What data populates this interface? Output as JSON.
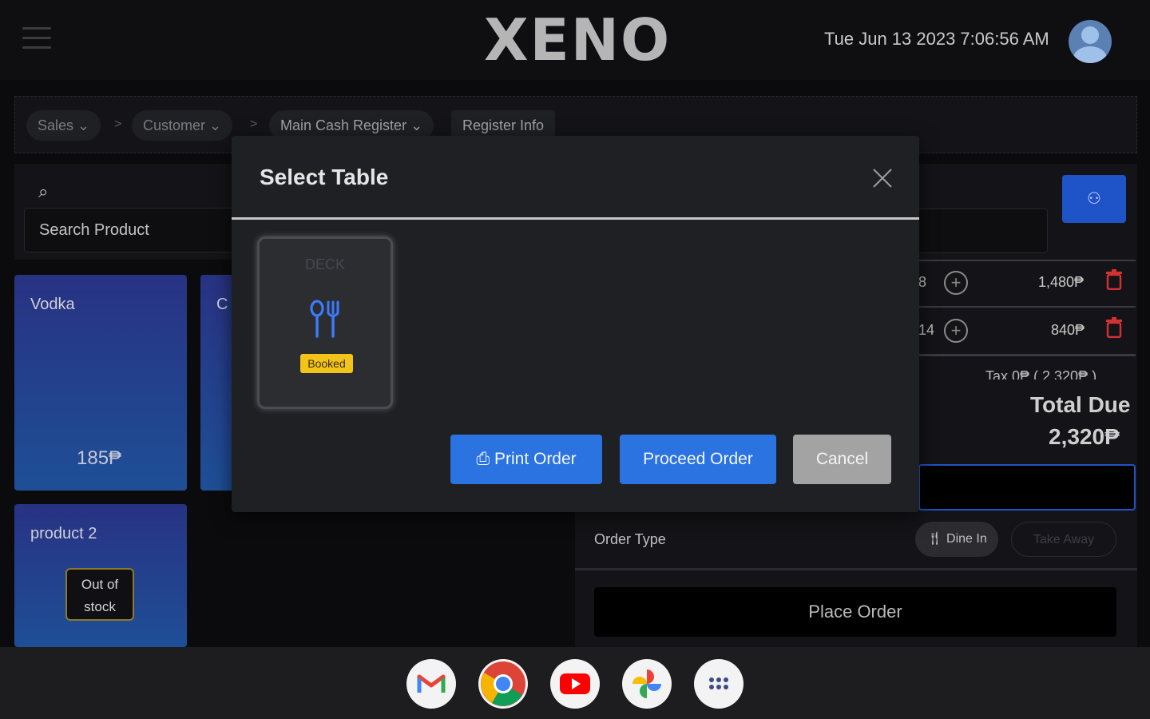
{
  "header": {
    "logo_text": "XENO",
    "datetime": "Tue Jun 13 2023 7:06:56 AM"
  },
  "breadcrumb": {
    "items": [
      "Sales",
      "Customer",
      "Main Cash Register",
      "Register Info"
    ],
    "separator": ">"
  },
  "products": {
    "search_placeholder": "Search Product",
    "items": [
      {
        "name": "Vodka",
        "price": "185₱"
      },
      {
        "name": "C",
        "price": ""
      },
      {
        "name": "product 2",
        "status": "Out of stock",
        "status_line1": "Out of",
        "status_line2": "stock"
      }
    ]
  },
  "cart": {
    "rows": [
      {
        "qty": "8",
        "amount": "1,480₱"
      },
      {
        "qty": "14",
        "amount": "840₱"
      }
    ],
    "tax_text": "Tax 0₱ ( 2,320₱ )",
    "total_label": "Total Due",
    "total_value": "2,320₱",
    "order_type_label": "Order Type",
    "order_types": [
      "Dine In",
      "Take Away"
    ],
    "place_order_label": "Place Order"
  },
  "modal": {
    "title": "Select Table",
    "table": {
      "name": "DECK",
      "status": "Booked"
    },
    "buttons": {
      "print": "Print Order",
      "proceed": "Proceed Order",
      "cancel": "Cancel"
    }
  },
  "shelf": {
    "apps": [
      "gmail-icon",
      "chrome-icon",
      "youtube-icon",
      "google-photos-icon",
      "app-launcher-icon"
    ]
  },
  "colors": {
    "accent_blue": "#2b73e0",
    "booked_yellow": "#f2c318",
    "danger_red": "#d43232"
  }
}
